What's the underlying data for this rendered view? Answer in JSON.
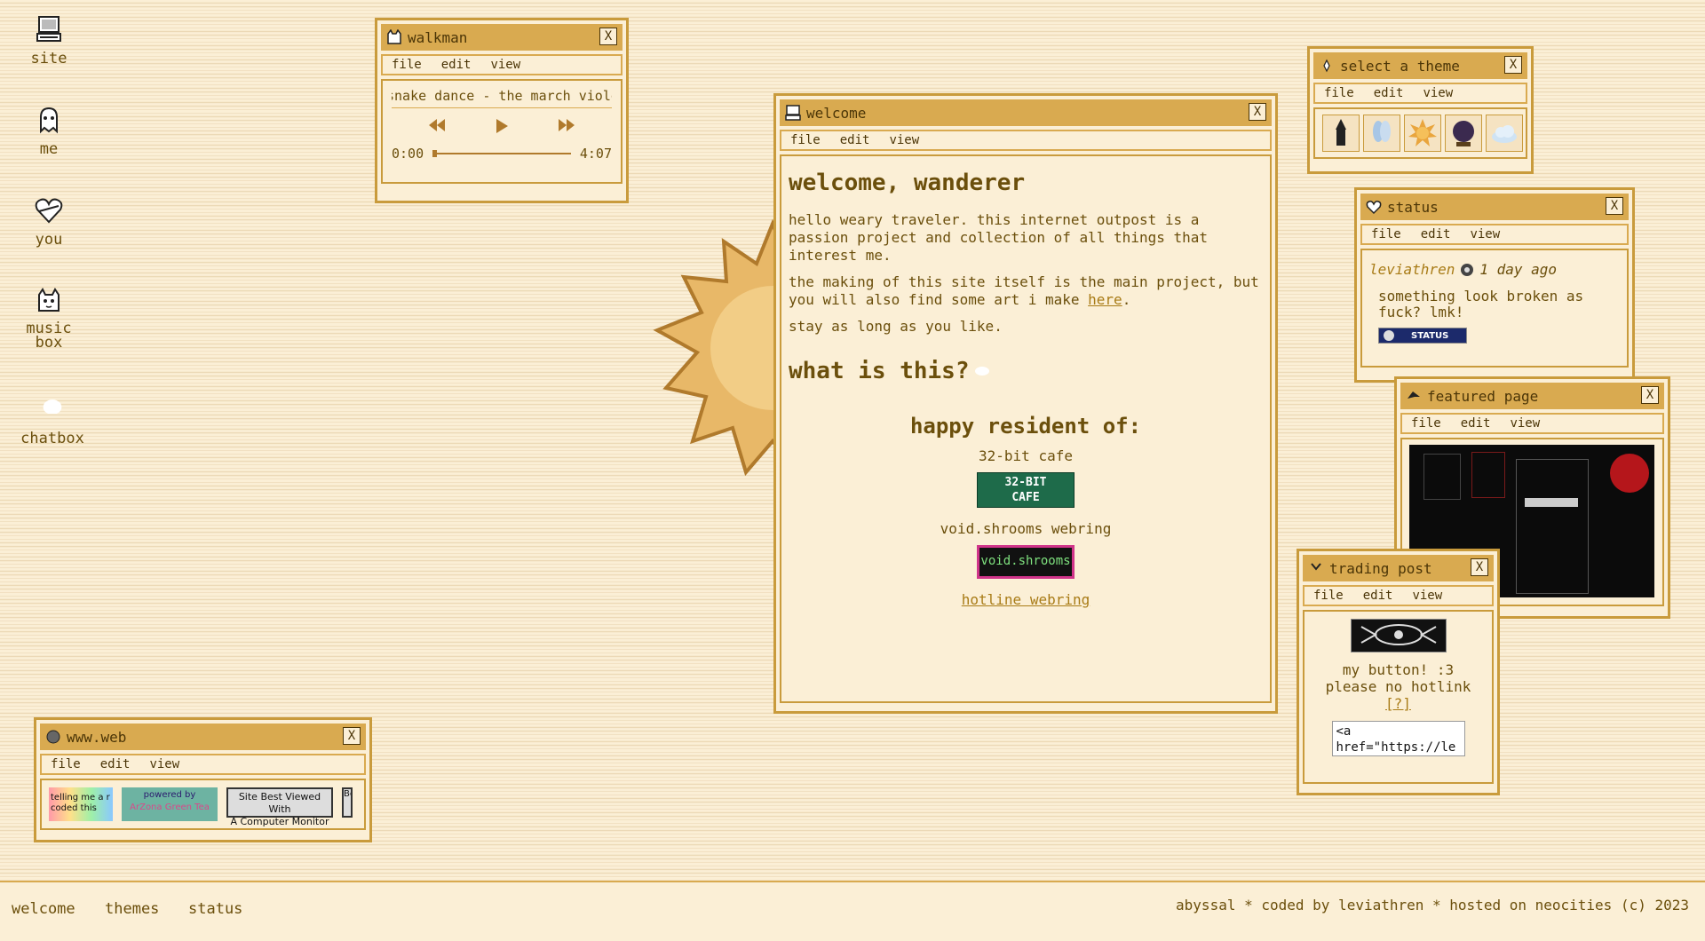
{
  "desktop": {
    "icons": [
      {
        "label": "site",
        "icon": "computer-icon"
      },
      {
        "label": "me",
        "icon": "ghost-icon"
      },
      {
        "label": "you",
        "icon": "heart-icon"
      },
      {
        "label": "music box",
        "icon": "cat-icon"
      },
      {
        "label": "chatbox",
        "icon": "chat-icon"
      }
    ]
  },
  "walkman": {
    "title": "walkman",
    "menu": [
      "file",
      "edit",
      "view"
    ],
    "track": "snake dance - the march violets",
    "time_current": "0:00",
    "time_total": "4:07",
    "progress": 0.0
  },
  "welcome": {
    "title": "welcome",
    "menu": [
      "file",
      "edit",
      "view"
    ],
    "heading": "welcome, wanderer",
    "para1": "hello weary traveler. this internet outpost is a passion project and collection of all things that interest me.",
    "para2_before": "the making of this site itself is the main project, but you will also find some art i make ",
    "para2_link": "here",
    "para2_after": ".",
    "para3": "stay as long as you like.",
    "heading2": "what is this?",
    "heading3": "happy resident of:",
    "resident1": "32-bit cafe",
    "badge1_top": "32-BIT",
    "badge1_bottom": "CAFE",
    "resident2": "void.shrooms webring",
    "badge2_text": "void.shrooms",
    "hotline_link": "hotline webring"
  },
  "theme": {
    "title": "select a theme",
    "menu": [
      "file",
      "edit",
      "view"
    ],
    "options": [
      "witch",
      "fairy",
      "sun",
      "crystal-ball",
      "cloud"
    ]
  },
  "status": {
    "title": "status",
    "menu": [
      "file",
      "edit",
      "view"
    ],
    "user": "leviathren",
    "time": "1 day ago",
    "message": "something look broken as fuck? lmk!",
    "badge": "STATUS"
  },
  "featured": {
    "title": "featured page",
    "menu": [
      "file",
      "edit",
      "view"
    ]
  },
  "trading": {
    "title": "trading post",
    "menu": [
      "file",
      "edit",
      "view"
    ],
    "line1": "my button! :3",
    "line2": "please no hotlink",
    "help_link": "[?]",
    "code": "<a href=\"https://leviathren.neocities.org\">"
  },
  "wwwweb": {
    "title": "www.web",
    "menu": [
      "file",
      "edit",
      "view"
    ],
    "button1": "telling me a r coded this",
    "button2_top": "powered by",
    "button2_bottom": "ArZona Green Tea",
    "button3_l1": "Site Best Viewed With",
    "button3_l2": "A Computer Monitor",
    "button4": "Be"
  },
  "taskbar": {
    "items": [
      "welcome",
      "themes",
      "status"
    ],
    "credit": "abyssal * coded by leviathren * hosted on neocities (c) 2023"
  },
  "colors": {
    "accent": "#d9aa50",
    "border": "#c99b3c",
    "text": "#6b4f0c",
    "link": "#a87b16",
    "background": "#fbefd6"
  }
}
